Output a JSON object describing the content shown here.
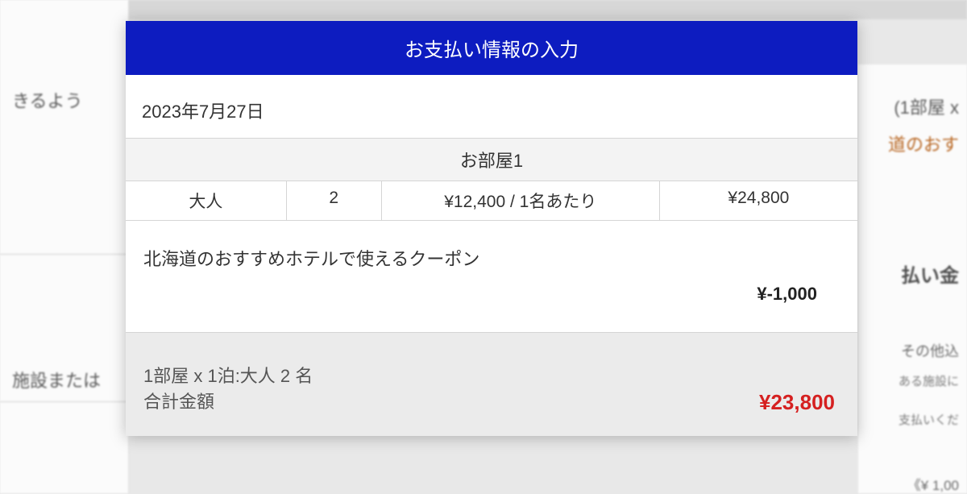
{
  "modal": {
    "title": "お支払い情報の入力",
    "date": "2023年7月27日",
    "room_header": "お部屋1",
    "row": {
      "type": "大人",
      "qty": "2",
      "unit_price": "¥12,400 / 1名あたり",
      "subtotal": "¥24,800"
    },
    "coupon": {
      "name": "北海道のおすすめホテルで使えるクーポン",
      "amount": "¥-1,000"
    },
    "total": {
      "summary_line1": "1部屋 x 1泊:大人 2 名",
      "summary_line2": "合計金額",
      "amount": "¥23,800"
    }
  },
  "background": {
    "left_text1": "きるよう",
    "left_text2": "施設または",
    "right_text1": "(1部屋 x",
    "right_text2": "道のおす",
    "right_text3": "払い金",
    "right_text4": "その他込",
    "right_text5": "ある施設に",
    "right_text6": "支払いくだ",
    "right_text7": "《¥ 1,00"
  }
}
